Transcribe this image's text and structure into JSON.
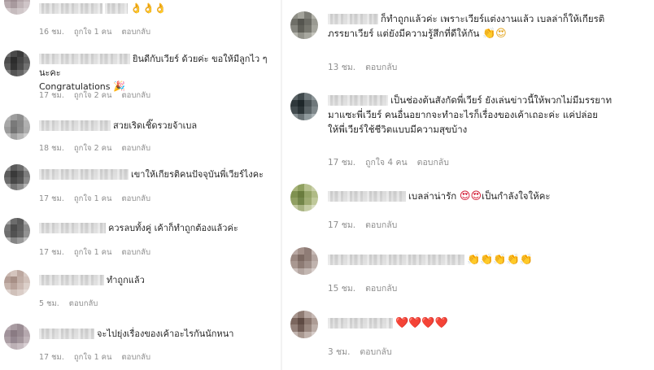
{
  "left_comments": [
    {
      "text": "",
      "emoji": "👌👌👌",
      "time": "16 ชม.",
      "likes": "ถูกใจ 1 คน",
      "reply": "ตอบกลับ"
    },
    {
      "text": "ยินดีกับเวียร์ ด้วยค่ะ ขอให้มีลูกไว ๆ นะคะ",
      "text2": "Congratulations",
      "emoji": "🎉",
      "time": "17 ชม.",
      "likes": "ถูกใจ 2 คน",
      "reply": "ตอบกลับ"
    },
    {
      "text": "สวยเริดเชิ๊ดรวยจ้าเบล",
      "time": "18 ชม.",
      "likes": "ถูกใจ 2 คน",
      "reply": "ตอบกลับ"
    },
    {
      "text": "เขาให้เกียรติคนปัจจุบันพี่เวียร์ไงคะ",
      "time": "17 ชม.",
      "likes": "ถูกใจ 1 คน",
      "reply": "ตอบกลับ"
    },
    {
      "text": "ควรลบทั้งคู่ เค้าก็ทำถูกต้องแล้วค่ะ",
      "time": "17 ชม.",
      "likes": "ถูกใจ 1 คน",
      "reply": "ตอบกลับ"
    },
    {
      "text": "ทำถูกแล้ว",
      "time": "5 ชม.",
      "reply": "ตอบกลับ"
    },
    {
      "text": "จะไปยุ่งเรื่องของเค้าอะไรกันนักหนา",
      "time": "17 ชม.",
      "likes": "ถูกใจ 1 คน",
      "reply": "ตอบกลับ"
    }
  ],
  "right_comments": [
    {
      "text": "ก็ทำถูกแล้วค่ะ เพราะเวียร์แต่งงานแล้ว เบลล่าก็ให้เกียรติ",
      "text2": "ภรรยาเวียร์ แต่ยังมีความรู้สึกที่ดีให้กัน",
      "emoji": "👏😍",
      "time": "13 ชม.",
      "reply": "ตอบกลับ"
    },
    {
      "text": "เป็นช่องต้นสังกัดพี่เวียร์ ยังเล่นข่าวนี้ให้พวกไม่มีมรรยาท",
      "text2": "มาแซะพี่เวียร์ คนอื่นอยากจะทำอะไรก็เรื่องของเค้าเถอะค่ะ แค่ปล่อย",
      "text3": "ให้พี่เวียร์ใช้ชีวิตแบบมีความสุขบ้าง",
      "time": "17 ชม.",
      "likes": "ถูกใจ 4 คน",
      "reply": "ตอบกลับ"
    },
    {
      "text": "เบลล่าน่ารัก",
      "emoji": "😍😍",
      "text_after": "เป็นกำลังใจให้คะ",
      "time": "17 ชม.",
      "reply": "ตอบกลับ"
    },
    {
      "text": "",
      "emoji": "👏👏👏👏👏",
      "time": "15 ชม.",
      "reply": "ตอบกลับ"
    },
    {
      "text": "",
      "emoji": "❤️❤️❤️❤️",
      "time": "3 ชม.",
      "reply": "ตอบกลับ"
    }
  ]
}
